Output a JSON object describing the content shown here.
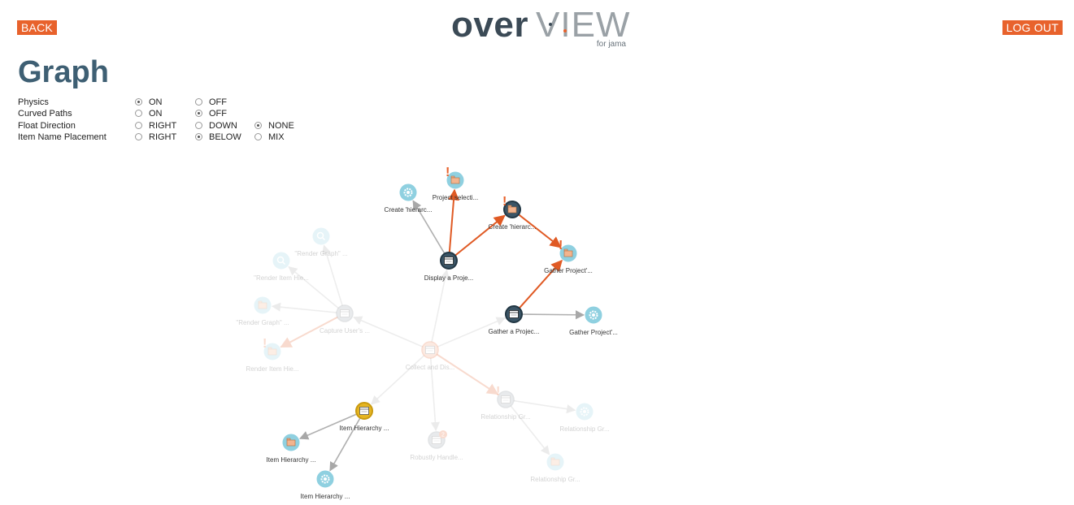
{
  "header": {
    "back_label": "BACK",
    "logout_label": "LOG OUT",
    "logo": {
      "word1": "over",
      "word2": "VIEW",
      "sub": "for jama"
    }
  },
  "page_title": "Graph",
  "options": [
    {
      "label": "Physics",
      "choices": [
        {
          "text": "ON",
          "selected": true
        },
        {
          "text": "OFF",
          "selected": false
        }
      ]
    },
    {
      "label": "Curved Paths",
      "choices": [
        {
          "text": "ON",
          "selected": false
        },
        {
          "text": "OFF",
          "selected": true
        }
      ]
    },
    {
      "label": "Float Direction",
      "choices": [
        {
          "text": "RIGHT",
          "selected": false
        },
        {
          "text": "DOWN",
          "selected": false
        },
        {
          "text": "NONE",
          "selected": true
        }
      ]
    },
    {
      "label": "Item Name Placement",
      "choices": [
        {
          "text": "RIGHT",
          "selected": false
        },
        {
          "text": "BELOW",
          "selected": true
        },
        {
          "text": "MIX",
          "selected": false
        }
      ]
    }
  ],
  "colors": {
    "accent": "#e8622c",
    "title": "#3e5f73",
    "node_light": "#8fd0e0",
    "node_dark": "#3b5566",
    "node_yellow": "#e6b521",
    "edge_gray": "#b5b5b5"
  },
  "graph": {
    "nodes": [
      {
        "id": "n1",
        "label": "Create 'hierarc...",
        "icon": "gear-icon",
        "style": "light",
        "faded": false,
        "warn": false
      },
      {
        "id": "n2",
        "label": "Project selecti...",
        "icon": "folder-icon",
        "style": "light",
        "faded": false,
        "warn": true
      },
      {
        "id": "n3",
        "label": "Create 'hierarc...",
        "icon": "folder-icon",
        "style": "dark",
        "faded": false,
        "warn": true
      },
      {
        "id": "n4",
        "label": "Display a Proje...",
        "icon": "window-icon",
        "style": "dark",
        "faded": false,
        "warn": false
      },
      {
        "id": "n5",
        "label": "Gather Project'...",
        "icon": "folder-icon",
        "style": "light",
        "faded": false,
        "warn": true
      },
      {
        "id": "n6",
        "label": "Gather a Projec...",
        "icon": "window-icon",
        "style": "dark",
        "faded": false,
        "warn": false
      },
      {
        "id": "n7",
        "label": "Gather Project'...",
        "icon": "gear-icon",
        "style": "light",
        "faded": false,
        "warn": false
      },
      {
        "id": "n8",
        "label": "\"Render Graph\" ...",
        "icon": "search-icon",
        "style": "light",
        "faded": true,
        "warn": false
      },
      {
        "id": "n9",
        "label": "\"Render Item Hie...",
        "icon": "search-icon",
        "style": "light",
        "faded": true,
        "warn": false
      },
      {
        "id": "n10",
        "label": "\"Render Graph\" ...",
        "icon": "folder-icon",
        "style": "light",
        "faded": true,
        "warn": false
      },
      {
        "id": "n11",
        "label": "Capture User's ...",
        "icon": "window-icon",
        "style": "gray",
        "faded": true,
        "warn": false
      },
      {
        "id": "n12",
        "label": "Render Item Hie...",
        "icon": "folder-icon",
        "style": "light",
        "faded": true,
        "warn": true
      },
      {
        "id": "n13",
        "label": "Collect and Dis...",
        "icon": "window-icon",
        "style": "orange",
        "faded": true,
        "warn": false
      },
      {
        "id": "n14",
        "label": "Relationship Gr...",
        "icon": "window-icon",
        "style": "gray",
        "faded": true,
        "warn": true
      },
      {
        "id": "n15",
        "label": "Relationship Gr...",
        "icon": "gear-icon",
        "style": "light",
        "faded": true,
        "warn": false
      },
      {
        "id": "n16",
        "label": "Relationship Gr...",
        "icon": "folder-icon",
        "style": "light",
        "faded": true,
        "warn": false
      },
      {
        "id": "n17",
        "label": "Robustly Handle...",
        "icon": "window-icon",
        "style": "gray",
        "faded": true,
        "warn": false,
        "badge": "2"
      },
      {
        "id": "n18",
        "label": "Item Hierarchy ...",
        "icon": "window-icon",
        "style": "yellow",
        "faded": false,
        "warn": false
      },
      {
        "id": "n19",
        "label": "Item Hierarchy ...",
        "icon": "folder-icon",
        "style": "light",
        "faded": false,
        "warn": false
      },
      {
        "id": "n20",
        "label": "Item Hierarchy ...",
        "icon": "gear-icon",
        "style": "light",
        "faded": false,
        "warn": false
      }
    ],
    "edges": [
      {
        "from": "n4",
        "to": "n1",
        "color": "gray",
        "faded": false
      },
      {
        "from": "n4",
        "to": "n2",
        "color": "orange",
        "faded": false
      },
      {
        "from": "n4",
        "to": "n3",
        "color": "orange",
        "faded": false
      },
      {
        "from": "n3",
        "to": "n5",
        "color": "orange",
        "faded": false
      },
      {
        "from": "n6",
        "to": "n5",
        "color": "orange",
        "faded": false
      },
      {
        "from": "n6",
        "to": "n7",
        "color": "gray",
        "faded": false
      },
      {
        "from": "n13",
        "to": "n4",
        "color": "gray",
        "faded": true
      },
      {
        "from": "n13",
        "to": "n6",
        "color": "gray",
        "faded": true
      },
      {
        "from": "n13",
        "to": "n11",
        "color": "gray",
        "faded": true
      },
      {
        "from": "n13",
        "to": "n14",
        "color": "orange",
        "faded": true
      },
      {
        "from": "n13",
        "to": "n17",
        "color": "gray",
        "faded": true
      },
      {
        "from": "n13",
        "to": "n18",
        "color": "gray",
        "faded": true
      },
      {
        "from": "n11",
        "to": "n8",
        "color": "gray",
        "faded": true
      },
      {
        "from": "n11",
        "to": "n9",
        "color": "gray",
        "faded": true
      },
      {
        "from": "n11",
        "to": "n10",
        "color": "gray",
        "faded": true
      },
      {
        "from": "n11",
        "to": "n12",
        "color": "orange",
        "faded": true
      },
      {
        "from": "n14",
        "to": "n15",
        "color": "gray",
        "faded": true
      },
      {
        "from": "n14",
        "to": "n16",
        "color": "gray",
        "faded": true
      },
      {
        "from": "n18",
        "to": "n19",
        "color": "gray",
        "faded": false
      },
      {
        "from": "n18",
        "to": "n20",
        "color": "gray",
        "faded": false
      }
    ]
  }
}
